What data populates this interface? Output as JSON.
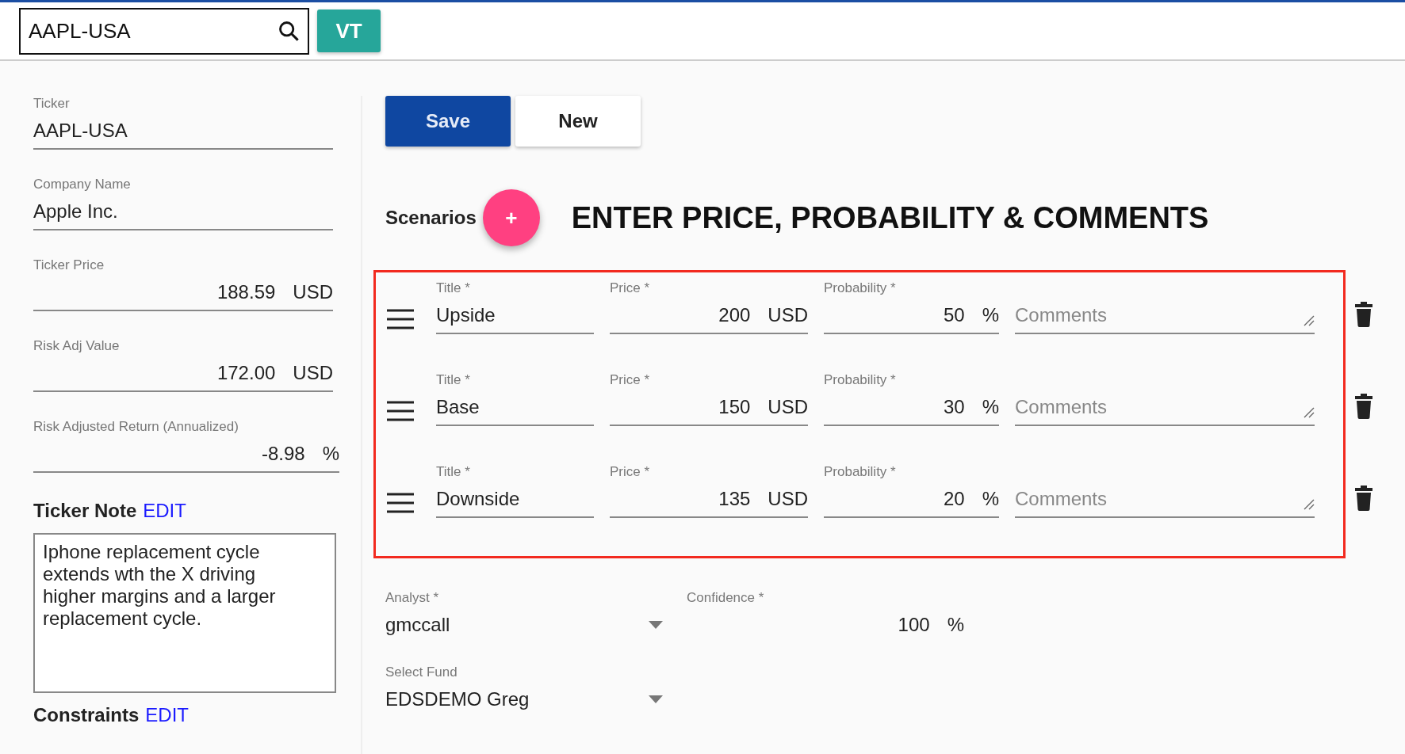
{
  "search": {
    "value": "AAPL-USA"
  },
  "vt_button": "VT",
  "details": [
    {
      "label": "Ticker",
      "value": "AAPL-USA",
      "kind": "text"
    },
    {
      "label": "Company Name",
      "value": "Apple Inc.",
      "kind": "text"
    },
    {
      "label": "Ticker Price",
      "value": "188.59",
      "unit": "USD",
      "kind": "number"
    },
    {
      "label": "Risk Adj Value",
      "value": "172.00",
      "unit": "USD",
      "kind": "number"
    },
    {
      "label": "Risk Adjusted Return (Annualized)",
      "value": "-8.98",
      "unit": "%",
      "kind": "number"
    }
  ],
  "ticker_note": {
    "heading": "Ticker Note",
    "edit": "EDIT",
    "text": "Iphone replacement cycle extends wth the X driving higher margins and a larger replacement cycle."
  },
  "constraints": {
    "heading": "Constraints",
    "edit": "EDIT"
  },
  "actions": [
    {
      "label": "Save",
      "primary": true
    },
    {
      "label": "New",
      "primary": false
    }
  ],
  "scenarios": {
    "heading": "Scenarios",
    "add": "+",
    "instruction": "ENTER PRICE, PROBABILITY & COMMENTS",
    "rows": [
      {
        "title_label": "Title *",
        "title": "Upside",
        "price_label": "Price *",
        "price": "200",
        "price_unit": "USD",
        "probability_label": "Probability *",
        "probability": "50",
        "probability_unit": "%",
        "comments_placeholder": "Comments"
      },
      {
        "title_label": "Title *",
        "title": "Base",
        "price_label": "Price *",
        "price": "150",
        "price_unit": "USD",
        "probability_label": "Probability *",
        "probability": "30",
        "probability_unit": "%",
        "comments_placeholder": "Comments"
      },
      {
        "title_label": "Title *",
        "title": "Downside",
        "price_label": "Price *",
        "price": "135",
        "price_unit": "USD",
        "probability_label": "Probability *",
        "probability": "20",
        "probability_unit": "%",
        "comments_placeholder": "Comments"
      }
    ]
  },
  "analyst": {
    "label": "Analyst *",
    "value": "gmccall"
  },
  "confidence": {
    "label": "Confidence *",
    "value": "100",
    "unit": "%"
  },
  "fund": {
    "label": "Select Fund",
    "value": "EDSDEMO Greg"
  }
}
